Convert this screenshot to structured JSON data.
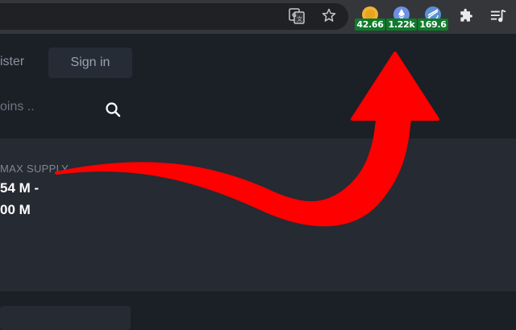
{
  "toolbar": {
    "icons": [
      "translate-icon",
      "star-icon",
      "puzzle-icon",
      "media-control-icon"
    ],
    "extensions": [
      {
        "name": "bitcoin",
        "badge": "42.66",
        "color": "#f2b233"
      },
      {
        "name": "ethereum",
        "badge": "1.22k",
        "color": "#6e8fe6"
      },
      {
        "name": "stellar",
        "badge": "169.6",
        "color": "#5a8fd8"
      }
    ],
    "badge_color": "#0f7a2b"
  },
  "page": {
    "register_label": "ister",
    "signin_label": "Sign in",
    "search_placeholder": "oins ..",
    "card": {
      "max_supply_label": "MAX SUPPLY",
      "max_supply_line1": "54 M -",
      "max_supply_line2": "00 M"
    }
  },
  "annotation": {
    "color": "#ff0000"
  }
}
